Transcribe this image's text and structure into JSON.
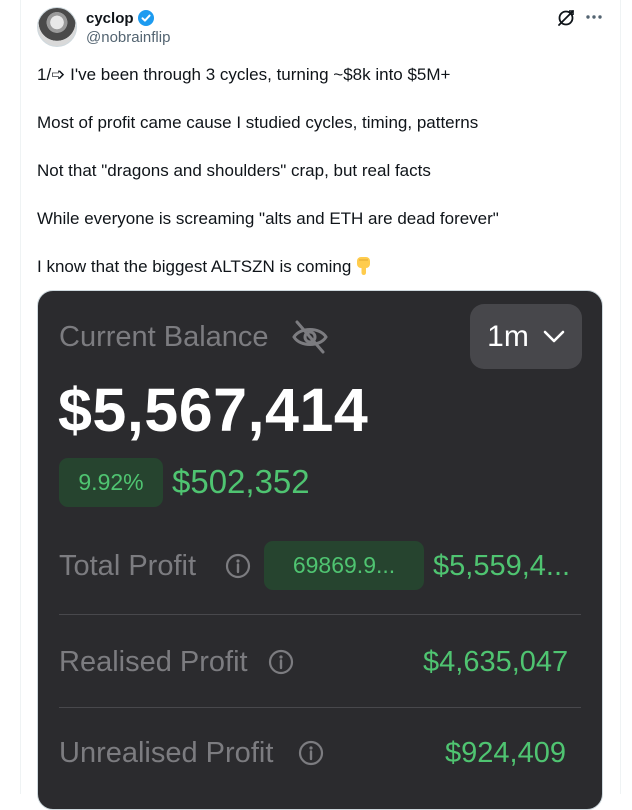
{
  "tweet": {
    "author_name": "cyclop",
    "handle": "@nobrainflip",
    "lines": [
      "1/➩ I've been through 3 cycles, turning ~$8k into $5M+",
      "Most of profit came cause I studied cycles, timing, patterns",
      "Not that \"dragons and shoulders\" crap, but real facts",
      "While everyone is screaming \"alts and ETH are dead forever\"",
      "I know that the biggest ALTSZN is coming"
    ],
    "icons": [
      "verified-badge-icon",
      "grok-icon",
      "more-icon",
      "pointing-down-emoji"
    ]
  },
  "media": {
    "current_balance_label": "Current Balance",
    "period": "1m",
    "balance": "$5,567,414",
    "change_percent": "9.92%",
    "change_amount": "$502,352",
    "total_profit_label": "Total Profit",
    "total_profit_percent": "69869.9...",
    "total_profit_amount": "$5,559,4...",
    "realised_profit_label": "Realised Profit",
    "realised_profit_amount": "$4,635,047",
    "unrealised_profit_label": "Unrealised Profit",
    "unrealised_profit_amount": "$924,409",
    "colors": {
      "panel": "#2b2b2e",
      "positive": "#4fc471",
      "positive_bg": "#26442f",
      "muted": "#7c7c80"
    },
    "icons": [
      "eye-off-icon",
      "chevron-down-icon",
      "info-icon"
    ]
  }
}
